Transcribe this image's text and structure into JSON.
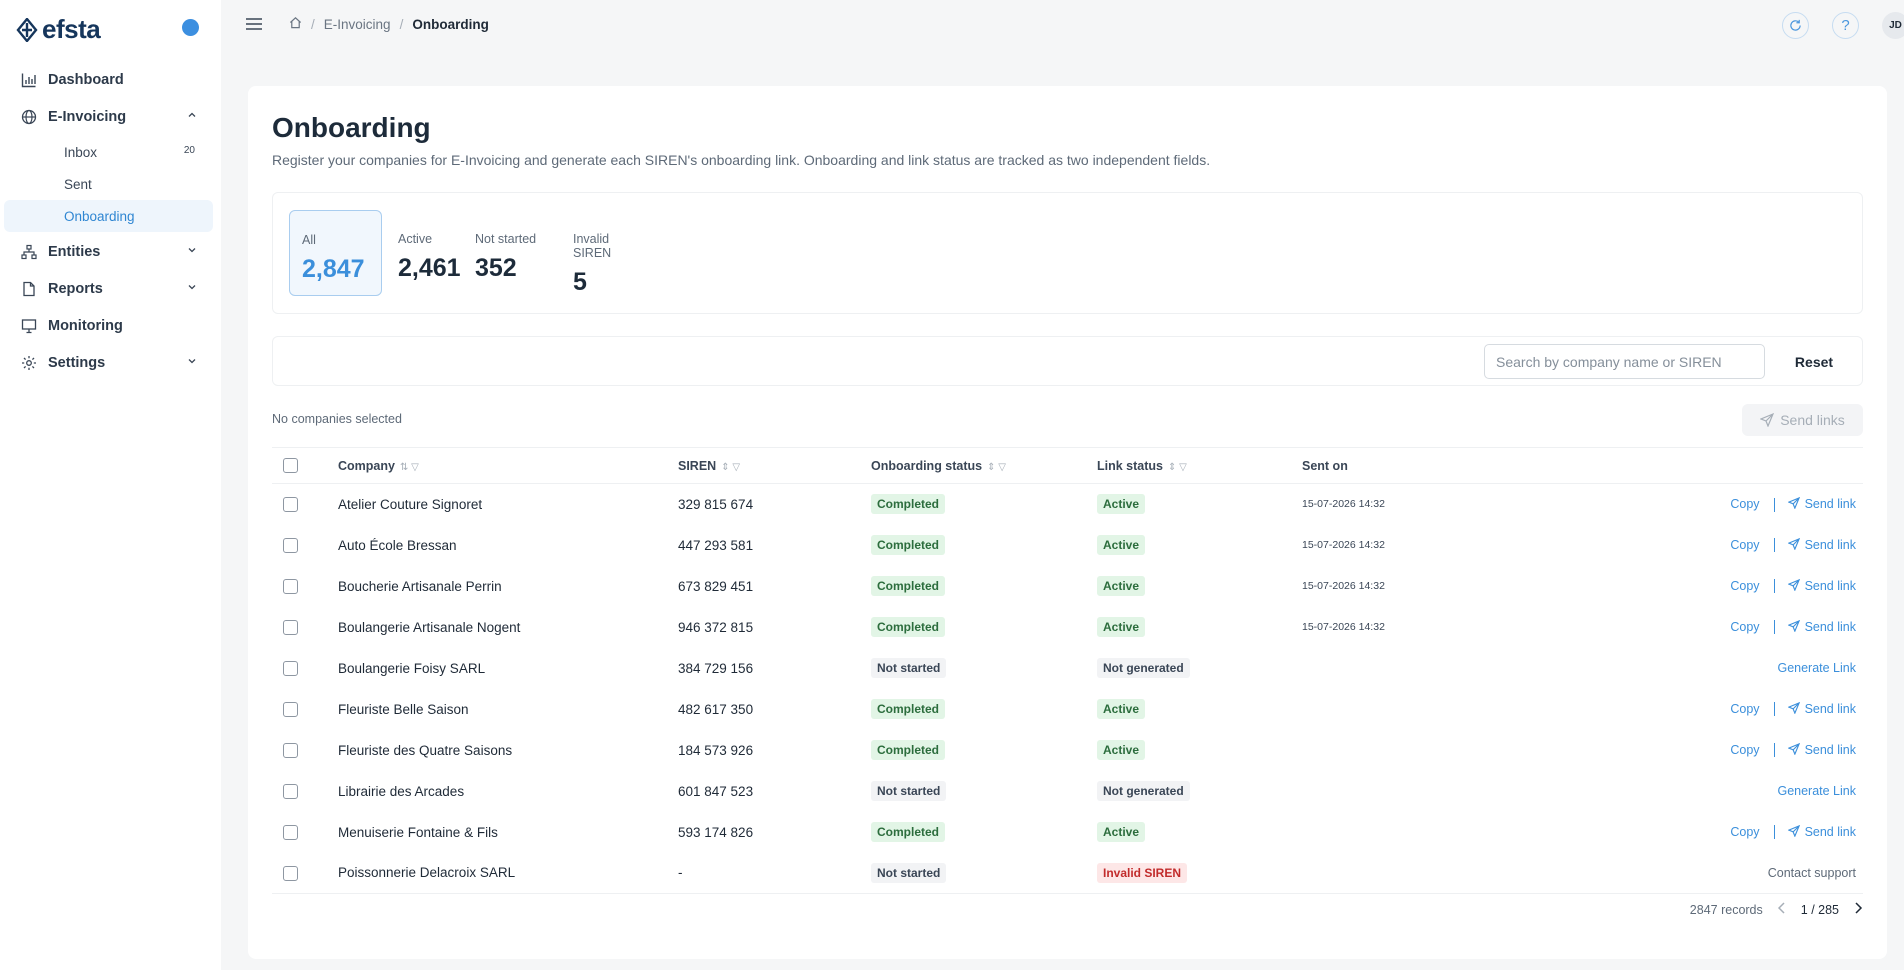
{
  "brand": {
    "name": "efsta"
  },
  "sidebar": {
    "items": [
      {
        "label": "Dashboard",
        "icon": "chart-bar-icon"
      },
      {
        "label": "E-Invoicing",
        "icon": "globe-icon",
        "expanded": true,
        "children": [
          {
            "label": "Inbox",
            "count": "20"
          },
          {
            "label": "Sent"
          },
          {
            "label": "Onboarding",
            "active": true
          }
        ]
      },
      {
        "label": "Entities",
        "icon": "hierarchy-icon"
      },
      {
        "label": "Reports",
        "icon": "file-icon"
      },
      {
        "label": "Monitoring",
        "icon": "monitor-icon"
      },
      {
        "label": "Settings",
        "icon": "gear-icon"
      }
    ]
  },
  "breadcrumb": {
    "parent": "E-Invoicing",
    "current": "Onboarding"
  },
  "topbar": {
    "avatar": "JD"
  },
  "page": {
    "title": "Onboarding",
    "description": "Register your companies for E-Invoicing and generate each SIREN's onboarding link. Onboarding and link status are tracked as two independent fields."
  },
  "stats": [
    {
      "label": "All",
      "value": "2,847",
      "selected": true
    },
    {
      "label": "Active",
      "value": "2,461"
    },
    {
      "label": "Not started",
      "value": "352"
    },
    {
      "label": "Invalid SIREN",
      "value": "5"
    }
  ],
  "search": {
    "placeholder": "Search by company name or SIREN",
    "value": "",
    "reset_label": "Reset"
  },
  "selection": {
    "info": "No companies selected",
    "send_links_label": "Send links"
  },
  "table": {
    "columns": [
      "Company",
      "SIREN",
      "Onboarding status",
      "Link status",
      "Sent on"
    ],
    "rows": [
      {
        "company": "Atelier Couture Signoret",
        "siren": "329 815 674",
        "onboarding": "Completed",
        "link": "Active",
        "sent_on": "15-07-2026 14:32",
        "actions": [
          "Copy",
          "Send link"
        ]
      },
      {
        "company": "Auto École Bressan",
        "siren": "447 293 581",
        "onboarding": "Completed",
        "link": "Active",
        "sent_on": "15-07-2026 14:32",
        "actions": [
          "Copy",
          "Send link"
        ]
      },
      {
        "company": "Boucherie Artisanale Perrin",
        "siren": "673 829 451",
        "onboarding": "Completed",
        "link": "Active",
        "sent_on": "15-07-2026 14:32",
        "actions": [
          "Copy",
          "Send link"
        ]
      },
      {
        "company": "Boulangerie Artisanale Nogent",
        "siren": "946 372 815",
        "onboarding": "Completed",
        "link": "Active",
        "sent_on": "15-07-2026 14:32",
        "actions": [
          "Copy",
          "Send link"
        ]
      },
      {
        "company": "Boulangerie Foisy SARL",
        "siren": "384 729 156",
        "onboarding": "Not started",
        "link": "Not generated",
        "sent_on": "",
        "actions": [
          "Generate Link"
        ]
      },
      {
        "company": "Fleuriste Belle Saison",
        "siren": "482 617 350",
        "onboarding": "Completed",
        "link": "Active",
        "sent_on": "",
        "actions": [
          "Copy",
          "Send link"
        ]
      },
      {
        "company": "Fleuriste des Quatre Saisons",
        "siren": "184 573 926",
        "onboarding": "Completed",
        "link": "Active",
        "sent_on": "",
        "actions": [
          "Copy",
          "Send link"
        ]
      },
      {
        "company": "Librairie des Arcades",
        "siren": "601 847 523",
        "onboarding": "Not started",
        "link": "Not generated",
        "sent_on": "",
        "actions": [
          "Generate Link"
        ]
      },
      {
        "company": "Menuiserie Fontaine & Fils",
        "siren": "593 174 826",
        "onboarding": "Completed",
        "link": "Active",
        "sent_on": "",
        "actions": [
          "Copy",
          "Send link"
        ]
      },
      {
        "company": "Poissonnerie Delacroix SARL",
        "siren": "-",
        "onboarding": "Not started",
        "link": "Invalid SIREN",
        "sent_on": "",
        "actions": [
          "Contact support"
        ]
      }
    ]
  },
  "pagination": {
    "records": "2847 records",
    "page": "1 / 285"
  },
  "colors": {
    "accent": "#3b8fdb",
    "success_bg": "#e2f5e6",
    "success_text": "#2c6d3d",
    "danger_bg": "#fde7e7",
    "danger_text": "#c22c2c"
  }
}
